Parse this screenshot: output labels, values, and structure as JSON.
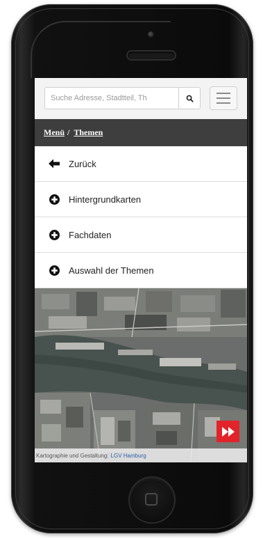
{
  "search": {
    "placeholder": "Suche Adresse, Stadtteil, Th"
  },
  "breadcrumb": {
    "items": [
      "Menü",
      "Themen"
    ],
    "separator": "/"
  },
  "menu": {
    "items": [
      {
        "label": "Zurück",
        "icon": "arrow-left-icon"
      },
      {
        "label": "Hintergrundkarten",
        "icon": "plus-circle-icon"
      },
      {
        "label": "Fachdaten",
        "icon": "plus-circle-icon"
      },
      {
        "label": "Auswahl der Themen",
        "icon": "plus-circle-icon"
      }
    ]
  },
  "map": {
    "attribution_text": "Kartographie und Gestaltung:",
    "attribution_link": "LGV Hamburg"
  },
  "colors": {
    "header_bar": "#3e3e3e",
    "accent_red": "#e2232a",
    "attribution_link": "#2a5ea8"
  }
}
